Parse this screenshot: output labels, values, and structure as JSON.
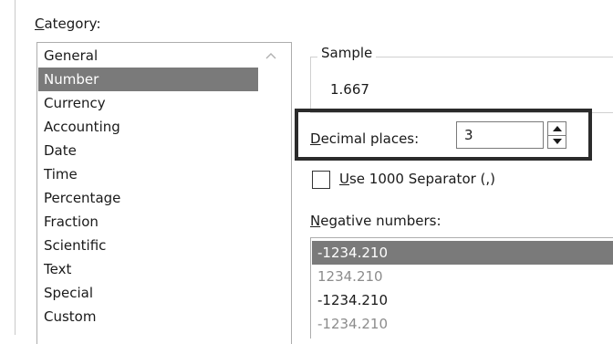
{
  "category": {
    "label_accel": "C",
    "label_rest": "ategory:",
    "items": [
      "General",
      "Number",
      "Currency",
      "Accounting",
      "Date",
      "Time",
      "Percentage",
      "Fraction",
      "Scientific",
      "Text",
      "Special",
      "Custom"
    ],
    "selected": "Number"
  },
  "sample": {
    "legend": "Sample",
    "value": "1.667"
  },
  "decimal_places": {
    "label_accel": "D",
    "label_rest": "ecimal places:",
    "value": "3"
  },
  "separator": {
    "label_accel": "U",
    "label_rest": "se 1000 Separator (,)",
    "checked": false
  },
  "negative_numbers": {
    "label_accel": "N",
    "label_rest": "egative numbers:",
    "items": [
      "-1234.210",
      "1234.210",
      "-1234.210",
      "-1234.210"
    ]
  },
  "colors": {
    "selection": "#7a7a7a",
    "highlight_border": "#2b2b2b",
    "gray_text": "#8c8c8c"
  }
}
